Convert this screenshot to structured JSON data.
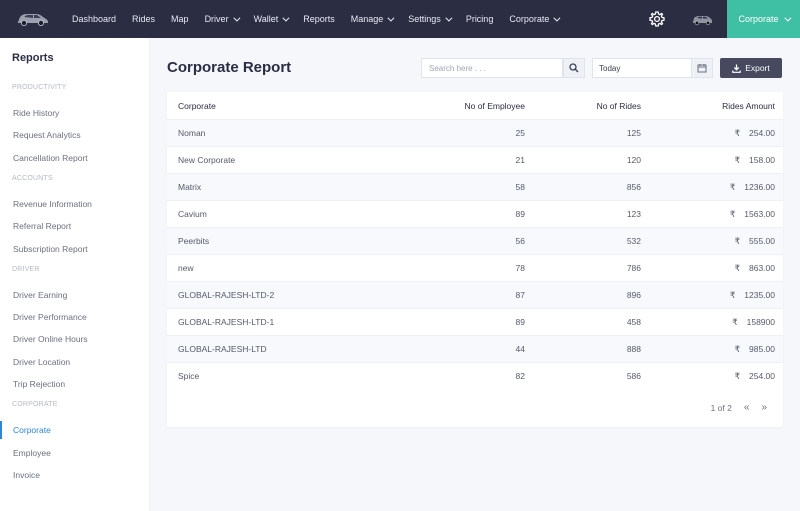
{
  "topnav": {
    "items": [
      {
        "label": "Dashboard",
        "dropdown": false
      },
      {
        "label": "Rides",
        "dropdown": false
      },
      {
        "label": "Map",
        "dropdown": false
      },
      {
        "label": "Driver",
        "dropdown": true
      },
      {
        "label": "Wallet",
        "dropdown": true
      },
      {
        "label": "Reports",
        "dropdown": false
      },
      {
        "label": "Manage",
        "dropdown": true
      },
      {
        "label": "Settings",
        "dropdown": true
      },
      {
        "label": "Pricing",
        "dropdown": false
      },
      {
        "label": "Corporate",
        "dropdown": true
      }
    ],
    "account_label": "Corporate",
    "accent_color": "#3fc0a5",
    "bar_color": "#2b2d43"
  },
  "sidebar": {
    "title": "Reports",
    "sections": [
      {
        "heading": "PRODUCTIVITY",
        "links": [
          "Ride History",
          "Request Analytics",
          "Cancellation Report"
        ]
      },
      {
        "heading": "ACCOUNTS",
        "links": [
          "Revenue Information",
          "Referral Report",
          "Subscription Report"
        ]
      },
      {
        "heading": "DRIVER",
        "links": [
          "Driver Earning",
          "Driver Performance",
          "Driver Online Hours",
          "Driver Location",
          "Trip Rejection"
        ]
      },
      {
        "heading": "CORPORATE",
        "links": [
          "Corporate",
          "Employee",
          "Invoice"
        ]
      }
    ],
    "active_link": "Corporate"
  },
  "main": {
    "title": "Corporate Report",
    "search_placeholder": "Search here . . .",
    "date_value": "Today",
    "export_label": "Export",
    "columns": [
      "Corporate",
      "No of Employee",
      "No of Rides",
      "Rides Amount"
    ],
    "currency_symbol": "₹",
    "rows": [
      {
        "corporate": "Noman",
        "employees": "25",
        "rides": "125",
        "amount": "254.00"
      },
      {
        "corporate": "New Corporate",
        "employees": "21",
        "rides": "120",
        "amount": "158.00"
      },
      {
        "corporate": "Matrix",
        "employees": "58",
        "rides": "856",
        "amount": "1236.00"
      },
      {
        "corporate": "Cavium",
        "employees": "89",
        "rides": "123",
        "amount": "1563.00"
      },
      {
        "corporate": "Peerbits",
        "employees": "56",
        "rides": "532",
        "amount": "555.00"
      },
      {
        "corporate": "new",
        "employees": "78",
        "rides": "786",
        "amount": "863.00"
      },
      {
        "corporate": "GLOBAL-RAJESH-LTD-2",
        "employees": "87",
        "rides": "896",
        "amount": "1235.00"
      },
      {
        "corporate": "GLOBAL-RAJESH-LTD-1",
        "employees": "89",
        "rides": "458",
        "amount": "158900"
      },
      {
        "corporate": "GLOBAL-RAJESH-LTD",
        "employees": "44",
        "rides": "888",
        "amount": "985.00"
      },
      {
        "corporate": "Spice",
        "employees": "82",
        "rides": "586",
        "amount": "254.00"
      }
    ],
    "pagination": "1 of 2",
    "prev_glyph": "«",
    "next_glyph": "»"
  }
}
